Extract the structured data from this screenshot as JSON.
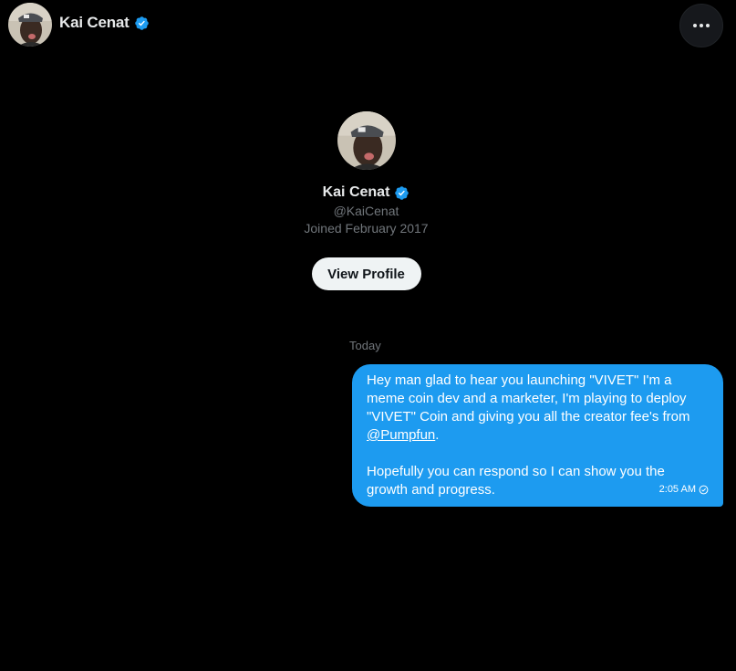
{
  "header": {
    "name": "Kai Cenat",
    "avatar_icon": "avatar-photo",
    "verified_icon": "verified-badge-icon",
    "more_icon": "more-horizontal-icon"
  },
  "profile": {
    "name": "Kai Cenat",
    "handle": "@KaiCenat",
    "joined": "Joined February 2017",
    "view_profile_label": "View Profile"
  },
  "conversation": {
    "date_divider": "Today",
    "messages": [
      {
        "direction": "outgoing",
        "line1": "Hey man glad to hear you launching \"VIVET\" I'm a",
        "line2": "meme coin dev and a marketer, I'm playing to deploy",
        "line3": "\"VIVET\" Coin and giving you all the creator fee's from",
        "mention": "@Pumpfun",
        "mention_suffix": ".",
        "line5": "Hopefully you can respond so I can show you the",
        "line6": "growth and progress.",
        "time": "2:05 AM",
        "status_icon": "sent-check-icon"
      }
    ]
  },
  "colors": {
    "background": "#000000",
    "bubble": "#1d9bf0",
    "verified": "#1d9bf0",
    "muted_text": "#71767b",
    "primary_text": "#e7e9ea"
  }
}
